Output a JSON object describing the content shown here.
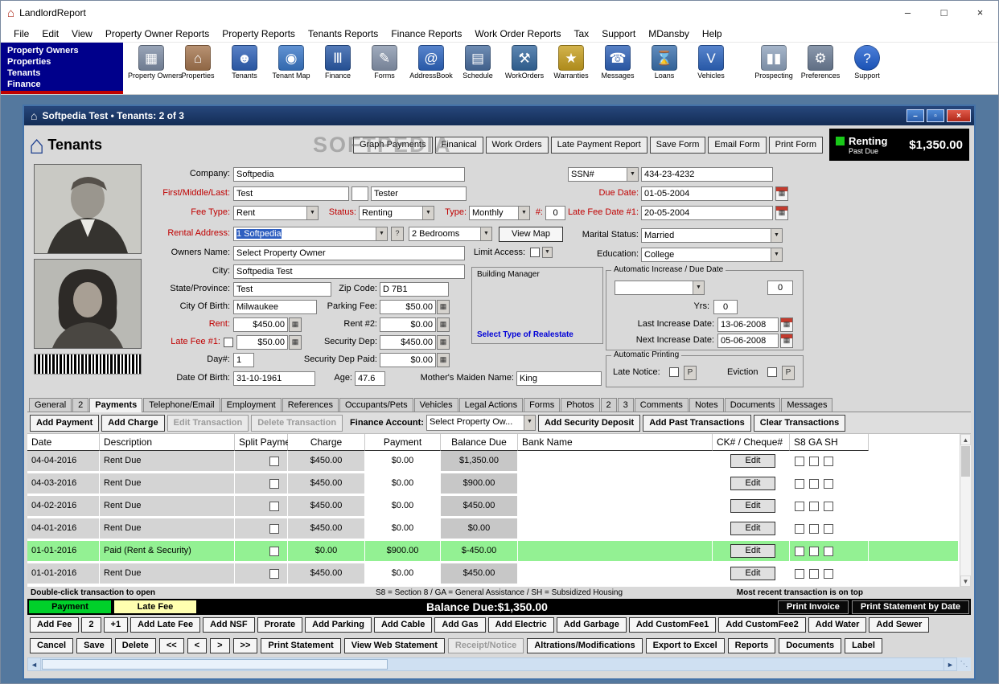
{
  "window": {
    "title": "LandlordReport",
    "controls": {
      "minimize": "–",
      "maximize": "□",
      "close": "×"
    },
    "menu": [
      "File",
      "Edit",
      "View",
      "Property Owner Reports",
      "Property Reports",
      "Tenants Reports",
      "Finance Reports",
      "Work Order Reports",
      "Tax",
      "Support",
      "MDansby",
      "Help"
    ]
  },
  "nav_panel": {
    "items": [
      "Property Owners",
      "Properties",
      "Tenants",
      "Finance"
    ]
  },
  "toolbar": {
    "items": [
      {
        "label": "Property Owners",
        "icon": "property-owners-icon",
        "glyph": "▦",
        "color": "#7f8ea6"
      },
      {
        "label": "Properties",
        "icon": "properties-icon",
        "glyph": "⌂",
        "color": "#a5764f"
      },
      {
        "label": "Tenants",
        "icon": "tenants-icon",
        "glyph": "☻",
        "color": "#2f62b8"
      },
      {
        "label": "Tenant Map",
        "icon": "tenant-map-icon",
        "glyph": "◉",
        "color": "#3a78c8"
      },
      {
        "label": "Finance",
        "icon": "finance-icon",
        "glyph": "Ⅲ",
        "color": "#2b5ba8"
      },
      {
        "label": "Forms",
        "icon": "forms-icon",
        "glyph": "✎",
        "color": "#8896ad"
      },
      {
        "label": "AddressBook",
        "icon": "address-book-icon",
        "glyph": "@",
        "color": "#2e66c0"
      },
      {
        "label": "Schedule",
        "icon": "schedule-icon",
        "glyph": "▤",
        "color": "#4a6fa0"
      },
      {
        "label": "WorkOrders",
        "icon": "work-orders-icon",
        "glyph": "⚒",
        "color": "#35699f"
      },
      {
        "label": "Warranties",
        "icon": "warranties-icon",
        "glyph": "★",
        "color": "#c8a020"
      },
      {
        "label": "Messages",
        "icon": "messages-icon",
        "glyph": "☎",
        "color": "#2f62b8"
      },
      {
        "label": "Loans",
        "icon": "loans-icon",
        "glyph": "⌛",
        "color": "#3a70ad"
      },
      {
        "label": "Vehicles",
        "icon": "vehicles-icon",
        "glyph": "V",
        "color": "#2e66c0"
      },
      {
        "label": "Prospecting",
        "icon": "prospecting-icon",
        "glyph": "▮▮",
        "color": "#8fa3bd",
        "gap": true
      },
      {
        "label": "Preferences",
        "icon": "preferences-icon",
        "glyph": "⚙",
        "color": "#6e7f98"
      },
      {
        "label": "Support",
        "icon": "support-icon",
        "glyph": "?",
        "color": "#1f5fd0",
        "round": true
      }
    ]
  },
  "inner_window": {
    "title": "Softpedia Test   •   Tenants: 2 of 3",
    "controls": {
      "minimize": "–",
      "restore": "▫",
      "close": "×"
    },
    "page_title": "Tenants",
    "watermark": "SOFTPEDIA",
    "header_buttons": [
      "Graph Payments",
      "Finanical",
      "Work Orders",
      "Late Payment Report",
      "Save Form",
      "Email Form",
      "Print Form"
    ],
    "status": {
      "label": "Renting",
      "sub": "Past Due",
      "amount": "$1,350.00"
    }
  },
  "form": {
    "labels": {
      "company": "Company:",
      "name": "First/Middle/Last:",
      "fee_type": "Fee Type:",
      "status": "Status:",
      "type": "Type:",
      "num": "#:",
      "rental_address": "Rental Address:",
      "owners_name": "Owners Name:",
      "limit_access": "Limit Access:",
      "city": "City:",
      "state": "State/Province:",
      "zip": "Zip Code:",
      "city_of_birth": "City Of Birth:",
      "parking_fee": "Parking Fee:",
      "rent": "Rent:",
      "rent2": "Rent #2:",
      "late_fee1": "Late Fee #1:",
      "security_dep": "Security Dep:",
      "day": "Day#:",
      "security_dep_paid": "Security Dep Paid:",
      "dob": "Date Of Birth:",
      "age": "Age:",
      "mother": "Mother's Maiden Name:",
      "ssn": "SSN#",
      "due_date": "Due Date:",
      "late_fee_date1": "Late Fee Date #1:",
      "marital": "Marital Status:",
      "education": "Education:"
    },
    "values": {
      "company": "Softpedia",
      "first": "Test",
      "middle": "",
      "last": "Tester",
      "fee_type": "Rent",
      "status": "Renting",
      "type": "Monthly",
      "num": "0",
      "rental_address": "1 Softpedia",
      "bedrooms": "2 Bedrooms",
      "owners_name": "Select Property Owner",
      "city": "Softpedia Test",
      "state": "Test",
      "zip": "D 7B1",
      "city_of_birth": "Milwaukee",
      "parking_fee": "$50.00",
      "rent": "$450.00",
      "rent2": "$0.00",
      "late_fee1": "$50.00",
      "security_dep": "$450.00",
      "day": "1",
      "security_dep_paid": "$0.00",
      "dob": "31-10-1961",
      "age": "47.6",
      "mother": "King",
      "ssn": "434-23-4232",
      "due_date": "01-05-2004",
      "late_fee_date1": "20-05-2004",
      "marital": "Married",
      "education": "College"
    },
    "buttons": {
      "help": "?",
      "view_map": "View Map"
    },
    "building_manager": {
      "title": "Building Manager",
      "link": "Select Type of Realestate"
    },
    "auto_increase": {
      "title": "Automatic Increase / Due Date",
      "amount": "0",
      "yrs_label": "Yrs:",
      "yrs": "0",
      "last_label": "Last Increase Date:",
      "last": "13-06-2008",
      "next_label": "Next Increase Date:",
      "next": "05-06-2008"
    },
    "auto_printing": {
      "title": "Automatic Printing",
      "late_notice": "Late Notice:",
      "p": "P",
      "eviction": "Eviction"
    }
  },
  "tabs": {
    "active_index": 2,
    "items": [
      "General",
      "2",
      "Payments",
      "Telephone/Email",
      "Employment",
      "References",
      "Occupants/Pets",
      "Vehicles",
      "Legal Actions",
      "Forms",
      "Photos",
      "2",
      "3",
      "Comments",
      "Notes",
      "Documents",
      "Messages"
    ]
  },
  "payments": {
    "toolbar": {
      "buttons": [
        {
          "label": "Add Payment"
        },
        {
          "label": "Add Charge"
        },
        {
          "label": "Edit Transaction",
          "disabled": true
        },
        {
          "label": "Delete Transaction",
          "disabled": true
        }
      ],
      "finance_label": "Finance Account:",
      "finance_value": "Select Property Ow...",
      "right_buttons": [
        "Add Security Deposit",
        "Add Past Transactions",
        "Clear Transactions"
      ]
    },
    "table": {
      "headers": [
        "Date",
        "Description",
        "Split Payment",
        "Charge",
        "Payment",
        "Balance Due",
        "Bank Name",
        "CK# / Cheque#",
        "S8 GA SH"
      ],
      "edit_label": "Edit",
      "rows": [
        {
          "date": "04-04-2016",
          "description": "Rent Due",
          "charge": "$450.00",
          "payment": "$0.00",
          "balance": "$1,350.00",
          "paid": false
        },
        {
          "date": "04-03-2016",
          "description": "Rent Due",
          "charge": "$450.00",
          "payment": "$0.00",
          "balance": "$900.00",
          "paid": false
        },
        {
          "date": "04-02-2016",
          "description": "Rent Due",
          "charge": "$450.00",
          "payment": "$0.00",
          "balance": "$450.00",
          "paid": false
        },
        {
          "date": "04-01-2016",
          "description": "Rent Due",
          "charge": "$450.00",
          "payment": "$0.00",
          "balance": "$0.00",
          "paid": false
        },
        {
          "date": "01-01-2016",
          "description": "Paid (Rent & Security)",
          "charge": "$0.00",
          "payment": "$900.00",
          "balance": "$-450.00",
          "paid": true
        },
        {
          "date": "01-01-2016",
          "description": "Rent Due",
          "charge": "$450.00",
          "payment": "$0.00",
          "balance": "$450.00",
          "paid": false
        }
      ]
    },
    "footer": {
      "left": "Double-click transaction to open",
      "center": "S8 = Section 8    /    GA = General Assistance    /    SH = Subsidized Housing",
      "right": "Most recent transaction is on top"
    },
    "summary": {
      "payment_legend": "Payment",
      "late_fee_legend": "Late Fee",
      "balance": "Balance Due:$1,350.00",
      "print_invoice": "Print Invoice",
      "print_statement": "Print Statement by Date"
    },
    "fee_buttons": [
      {
        "label": "Add Fee"
      },
      {
        "label": "2"
      },
      {
        "label": "+1"
      },
      {
        "label": "Add Late Fee"
      },
      {
        "label": "Add NSF"
      },
      {
        "label": "Prorate"
      },
      {
        "label": "Add Parking"
      },
      {
        "label": "Add Cable"
      },
      {
        "label": "Add Gas"
      },
      {
        "label": "Add Electric"
      },
      {
        "label": "Add Garbage"
      },
      {
        "label": "Add CustomFee1"
      },
      {
        "label": "Add CustomFee2"
      },
      {
        "label": "Add Water"
      },
      {
        "label": "Add Sewer"
      }
    ],
    "bottom_buttons": [
      {
        "label": "Cancel"
      },
      {
        "label": "Save"
      },
      {
        "label": "Delete"
      },
      {
        "label": "<<"
      },
      {
        "label": "<"
      },
      {
        "label": ">"
      },
      {
        "label": ">>"
      },
      {
        "label": "Print Statement"
      },
      {
        "label": "View Web Statement"
      },
      {
        "label": "Receipt/Notice",
        "disabled": true
      },
      {
        "label": "Altrations/Modifications"
      },
      {
        "label": "Export to Excel"
      },
      {
        "label": "Reports"
      },
      {
        "label": "Documents"
      },
      {
        "label": "Label"
      }
    ]
  },
  "colors": {
    "nav_blue": "#00008b",
    "mdi_blue": "#54789e",
    "title_navy": "#1b3a6b",
    "status_green": "#19c819",
    "paid_row_green": "#93f193",
    "red_label": "#c00000",
    "balance_bar": "#000000"
  }
}
